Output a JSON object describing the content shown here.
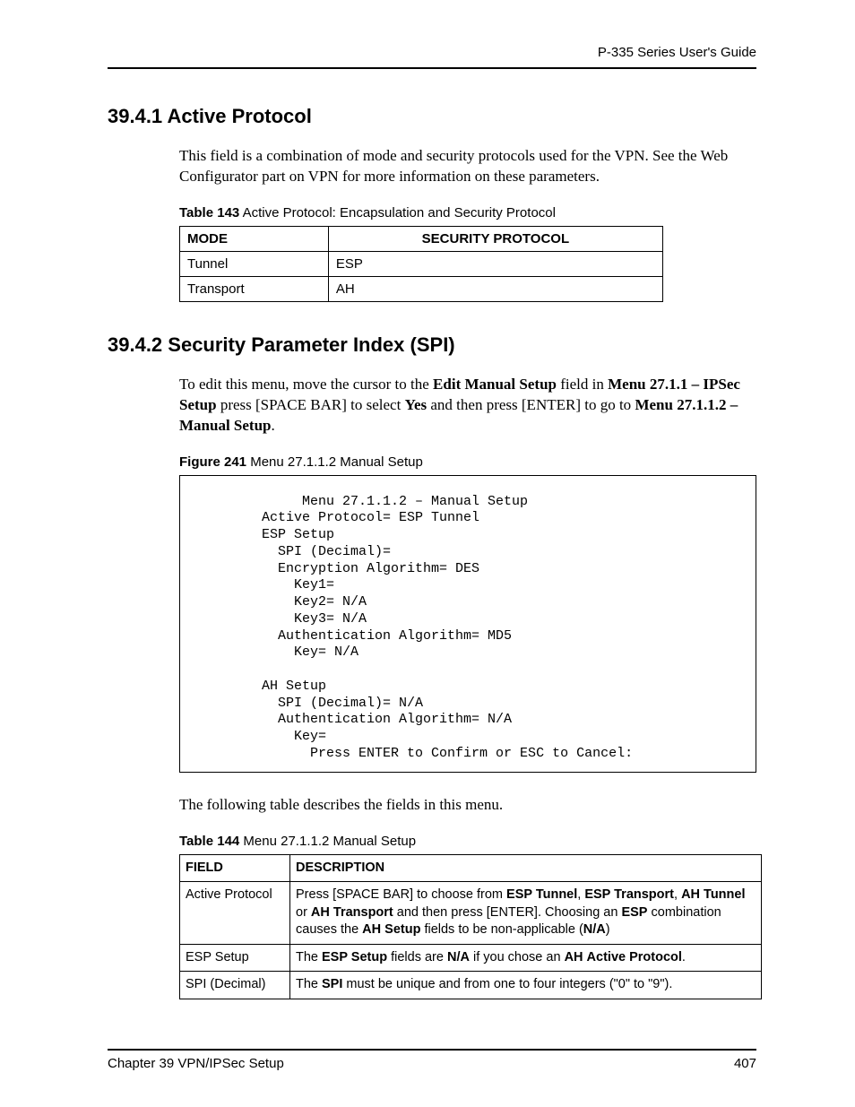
{
  "header": {
    "guide_title": "P-335 Series User's Guide"
  },
  "section1": {
    "heading": "39.4.1  Active Protocol",
    "para": "This field is a combination of mode and security protocols used for the VPN. See the Web Configurator part on VPN for more information on these parameters.",
    "table_label_bold": "Table 143",
    "table_label_rest": "   Active Protocol: Encapsulation and Security Protocol",
    "col1": "MODE",
    "col2": "SECURITY PROTOCOL",
    "rows": [
      {
        "mode": "Tunnel",
        "proto": "ESP"
      },
      {
        "mode": "Transport",
        "proto": "AH"
      }
    ]
  },
  "section2": {
    "heading": "39.4.2  Security Parameter Index (SPI)",
    "para_pre": "To edit this menu, move the cursor to the ",
    "para_b1": "Edit Manual Setup",
    "para_mid1": " field in ",
    "para_b2": "Menu 27.1.1 – IPSec Setup",
    "para_mid2": " press [SPACE BAR] to select ",
    "para_b3": "Yes",
    "para_mid3": " and then press [ENTER] to go to ",
    "para_b4": "Menu 27.1.1.2 – Manual Setup",
    "para_end": ".",
    "figure_label_bold": "Figure 241",
    "figure_label_rest": "   Menu 27.1.1.2 Manual Setup",
    "figure_text": "              Menu 27.1.1.2 – Manual Setup\n         Active Protocol= ESP Tunnel\n         ESP Setup\n           SPI (Decimal)=\n           Encryption Algorithm= DES\n             Key1=\n             Key2= N/A\n             Key3= N/A\n           Authentication Algorithm= MD5\n             Key= N/A\n\n         AH Setup\n           SPI (Decimal)= N/A\n           Authentication Algorithm= N/A\n             Key=\n               Press ENTER to Confirm or ESC to Cancel:",
    "after_figure_para": "The following table describes the fields in this menu.",
    "table2_label_bold": "Table 144",
    "table2_label_rest": "   Menu 27.1.1.2 Manual Setup",
    "t2_col1": "FIELD",
    "t2_col2": "DESCRIPTION",
    "t2_rows": {
      "r0_field": "Active Protocol",
      "r0_pre": "Press [SPACE BAR] to choose from ",
      "r0_b1": "ESP Tunnel",
      "r0_m1": ", ",
      "r0_b2": "ESP Transport",
      "r0_m2": ", ",
      "r0_b3": "AH Tunnel",
      "r0_m3": " or ",
      "r0_b4": "AH Transport",
      "r0_m4": " and then press [ENTER]. Choosing an ",
      "r0_b5": "ESP",
      "r0_m5": " combination causes the ",
      "r0_b6": "AH Setup",
      "r0_m6": " fields to be non-applicable (",
      "r0_b7": "N/A",
      "r0_m7": ")",
      "r1_field": "ESP Setup",
      "r1_pre": "The ",
      "r1_b1": "ESP Setup",
      "r1_m1": " fields are ",
      "r1_b2": "N/A",
      "r1_m2": " if you chose an ",
      "r1_b3": "AH",
      "r1_m3": " ",
      "r1_b4": "Active Protocol",
      "r1_m4": ".",
      "r2_field": "SPI (Decimal)",
      "r2_pre": "The ",
      "r2_b1": "SPI",
      "r2_m1": " must be unique and from one to four integers (\"0\" to \"9\")."
    }
  },
  "footer": {
    "left": "Chapter 39 VPN/IPSec Setup",
    "right": "407"
  }
}
